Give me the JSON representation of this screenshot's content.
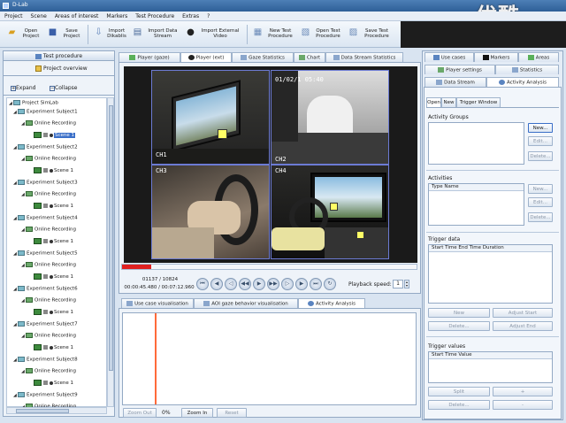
{
  "window": {
    "title": "D-Lab",
    "watermark": "优酷"
  },
  "menu": [
    "Project",
    "Scene",
    "Areas of interest",
    "Markers",
    "Test Procedure",
    "Extras",
    "?"
  ],
  "toolbar": [
    {
      "label": "Open\nProject",
      "icon": "folder-icon"
    },
    {
      "label": "Save\nProject",
      "icon": "floppy-icon"
    },
    {
      "label": "Import\nDikablis",
      "icon": "import-icon"
    },
    {
      "label": "Import Data\nStream",
      "icon": "data-stream-icon"
    },
    {
      "label": "Import External\nVideo",
      "icon": "video-icon"
    },
    {
      "label": "New Test\nProcedure",
      "icon": "new-doc-icon"
    },
    {
      "label": "Open Test\nProcedure",
      "icon": "open-doc-icon"
    },
    {
      "label": "Save Test\nProcedure",
      "icon": "save-doc-icon"
    }
  ],
  "left_panel": {
    "header": "Test procedure",
    "overview": "Project overview",
    "expand": "Expand",
    "collapse": "Collapse",
    "root": "Project SimLab",
    "subjects": [
      {
        "name": "Experiment Subject1",
        "recording": "Online Recording",
        "scene": "Scene 1",
        "selected": true
      },
      {
        "name": "Experiment Subject2",
        "recording": "Online Recording",
        "scene": "Scene 1"
      },
      {
        "name": "Experiment Subject3",
        "recording": "Online Recording",
        "scene": "Scene 1"
      },
      {
        "name": "Experiment Subject4",
        "recording": "Online Recording",
        "scene": "Scene 1"
      },
      {
        "name": "Experiment Subject5",
        "recording": "Online Recording",
        "scene": "Scene 1"
      },
      {
        "name": "Experiment Subject6",
        "recording": "Online Recording",
        "scene": "Scene 1"
      },
      {
        "name": "Experiment Subject7",
        "recording": "Online Recording",
        "scene": "Scene 1"
      },
      {
        "name": "Experiment Subject8",
        "recording": "Online Recording",
        "scene": "Scene 1"
      },
      {
        "name": "Experiment Subject9",
        "recording": "Online Recording"
      }
    ]
  },
  "center_tabs": [
    "Player (gaze)",
    "Player (ext)",
    "Gaze Statistics",
    "Chart",
    "Data Stream Statistics"
  ],
  "center_active_tab": 1,
  "cameras": [
    {
      "id": "cam-1",
      "label": "CH1"
    },
    {
      "id": "cam-2",
      "label": "CH2",
      "timestamp": "01/02/1    05:40"
    },
    {
      "id": "cam-3",
      "label": "CH3"
    },
    {
      "id": "cam-4",
      "label": "CH4"
    }
  ],
  "player": {
    "progress_fraction": 0.1,
    "frame": "01137 / 10824",
    "time": "00:00:45.480 / 00:07:12.960",
    "playback_label": "Playback speed:",
    "playback_speed": "1",
    "controls": [
      "skip-start-icon",
      "prev-marker-icon",
      "step-back-icon",
      "rewind-icon",
      "play-icon",
      "forward-icon",
      "step-forward-icon",
      "next-marker-icon",
      "skip-end-icon",
      "loop-icon"
    ]
  },
  "bottom_tabs": [
    "Use case visualisation",
    "AOI gaze behavior visualisation",
    "Activity Analysis"
  ],
  "bottom_active_tab": 2,
  "bottom_controls": {
    "zoom_out": "Zoom Out",
    "zoom_pct": "0%",
    "zoom_in": "Zoom In",
    "reset": "Reset"
  },
  "right_tabs_row1": [
    {
      "label": "Use cases",
      "icon": "use-cases-icon"
    },
    {
      "label": "Markers",
      "icon": "marker-icon"
    },
    {
      "label": "Areas",
      "icon": "areas-icon"
    }
  ],
  "right_tabs_row2": [
    {
      "label": "Player settings",
      "icon": "settings-icon"
    },
    {
      "label": "Statistics",
      "icon": "statistics-icon"
    }
  ],
  "right_tabs_row3": [
    {
      "label": "Data Stream",
      "icon": "data-stream-icon"
    },
    {
      "label": "Activity Analysis",
      "icon": "activity-icon"
    }
  ],
  "analysis": {
    "subtabs": [
      "Open",
      "New",
      "Trigger Window"
    ],
    "activity_groups": {
      "title": "Activity Groups",
      "buttons": [
        "New...",
        "Edit...",
        "Delete..."
      ]
    },
    "activities": {
      "title": "Activities",
      "column": "Type Name",
      "buttons": [
        "New...",
        "Edit...",
        "Delete..."
      ]
    },
    "trigger_data": {
      "title": "Trigger data",
      "columns": "Start Time End Time Duration",
      "buttons": [
        "New",
        "Adjust Start",
        "Delete...",
        "Adjust End"
      ]
    },
    "trigger_values": {
      "title": "Trigger values",
      "columns": "Start Time Value",
      "buttons": [
        "Split",
        "+",
        "Delete...",
        "-"
      ]
    }
  },
  "colors": {
    "accent": "#3a6fc8",
    "progress": "#e02020",
    "marker": "#ff6a3a",
    "cam_border": "#6c7bd4"
  }
}
